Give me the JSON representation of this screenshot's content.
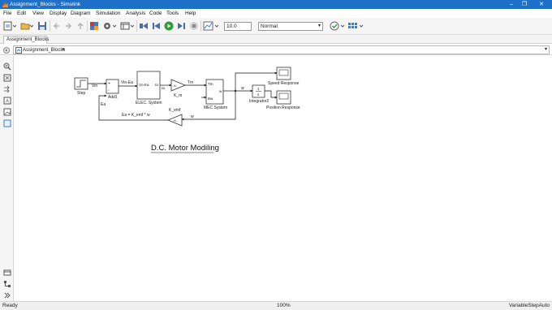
{
  "window": {
    "title": "Assignment_Blocks - Simulink",
    "minimize_glyph": "–",
    "maximize_glyph": "❐",
    "close_glyph": "✕"
  },
  "menu": [
    "File",
    "Edit",
    "View",
    "Display",
    "Diagram",
    "Simulation",
    "Analysis",
    "Code",
    "Tools",
    "Help"
  ],
  "toolbar": {
    "stop_time": "10.0",
    "simulation_mode": "Normal",
    "run_color": "#2e9c3a"
  },
  "tab": {
    "label": "Assignment_Blocks"
  },
  "breadcrumb": {
    "label": "Assignment_Blocks",
    "arrow": "▸",
    "dropdown": "▾"
  },
  "diagram": {
    "title": "D.C. Motor Modiling",
    "blocks": {
      "step": "Step",
      "add": "Add1",
      "elec_system": "ELEC. System",
      "elec_in": "Vn-Ea",
      "elec_out": "Ia",
      "gain_km": "K_m",
      "gain_km_symbol": "-K-",
      "mec_system": "MEC System",
      "mec_in1": "Tm",
      "mec_in2": "Bw",
      "mec_out": "w",
      "integrator": "Integrator2",
      "integrator_num": "1",
      "integrator_den": "s",
      "scope_speed": "Speed Response",
      "scope_position": "Position Response",
      "gain_kemf": "K_emf",
      "gain_kemf_symbol": "-K-"
    },
    "signals": {
      "vin": "Vin",
      "vin_ea": "Vin-Ea",
      "ia": "Ia",
      "tm": "Tm",
      "w_out": "w",
      "w_feedback": "w",
      "ea": "Ea",
      "ea_eq": "Ea = K_emf * w"
    }
  },
  "status": {
    "left": "Ready",
    "zoom": "100%",
    "solver": "VariableStepAuto"
  }
}
